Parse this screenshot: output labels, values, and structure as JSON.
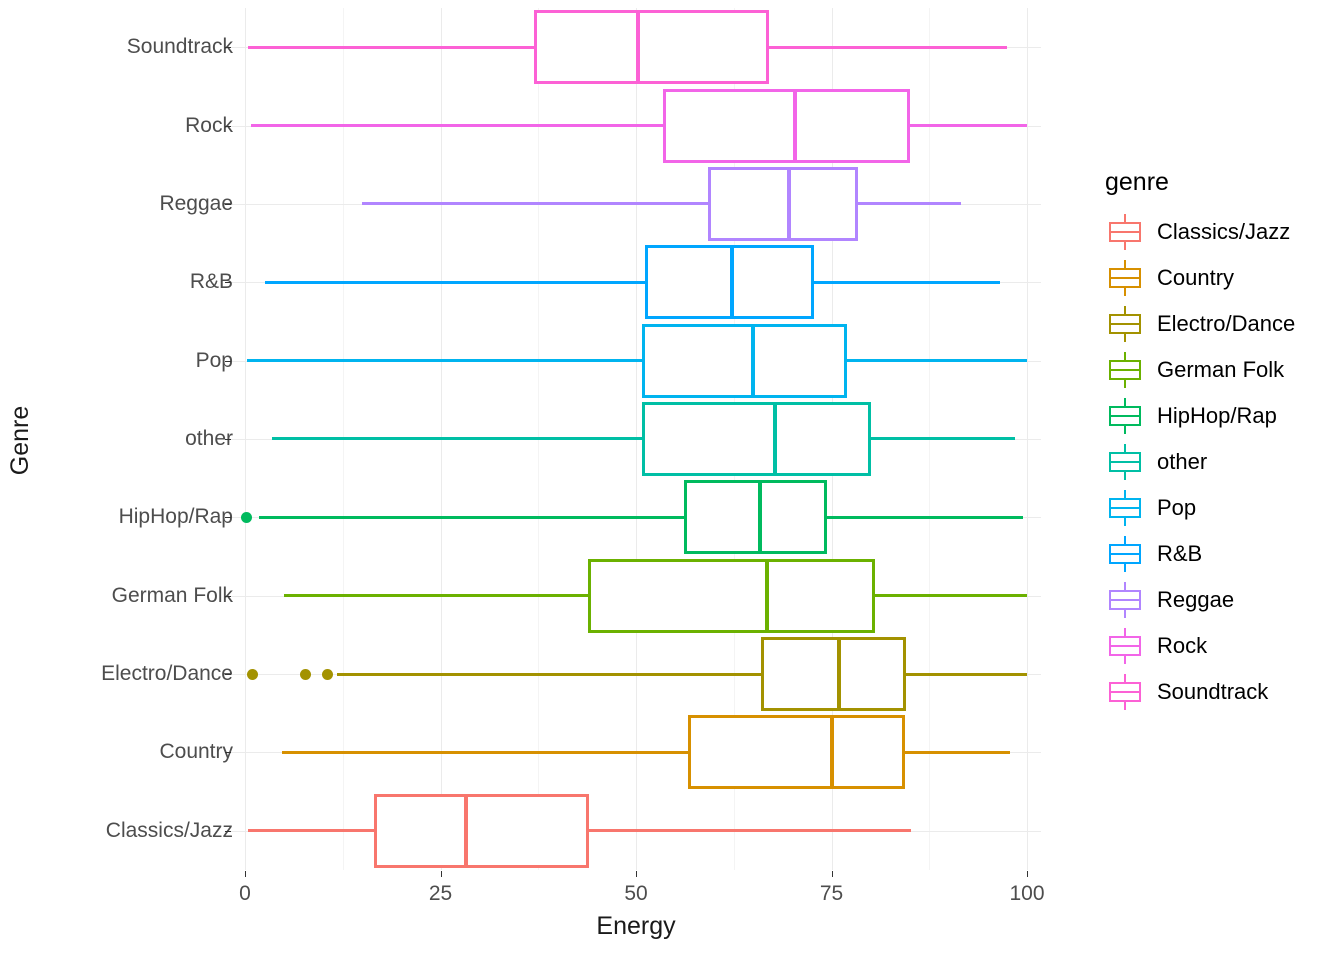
{
  "chart": {
    "type": "boxplot",
    "title": "",
    "xlabel": "Energy",
    "ylabel": "Genre",
    "legend_title": "genre",
    "legend_position": "right",
    "grid": true,
    "xlim": [
      -2,
      102
    ],
    "xticks": [
      "0",
      "25",
      "50",
      "75",
      "100"
    ],
    "xtick_values": [
      0,
      25,
      50,
      75,
      100
    ],
    "xminor_values": [
      12.5,
      37.5,
      62.5,
      87.5
    ]
  },
  "chart_data": {
    "type": "boxplot",
    "title": "",
    "xlabel": "Energy",
    "ylabel": "Genre",
    "legend_title": "genre",
    "legend_position": "right",
    "grid": true,
    "xlim": [
      -2,
      102
    ],
    "xticks": [
      0,
      25,
      50,
      75,
      100
    ],
    "orientation": "horizontal",
    "categories": [
      "Soundtrack",
      "Rock",
      "Reggae",
      "R&B",
      "Pop",
      "other",
      "HipHop/Rap",
      "German Folk",
      "Electro/Dance",
      "Country",
      "Classics/Jazz"
    ],
    "boxes": [
      {
        "category": "Soundtrack",
        "color": "#FC61D5",
        "whisker_low": 0.4,
        "q1": 37.0,
        "median": 50.2,
        "q3": 67.0,
        "whisker_high": 97.5,
        "outliers": []
      },
      {
        "category": "Rock",
        "color": "#F265E8",
        "whisker_low": 0.8,
        "q1": 53.5,
        "median": 70.3,
        "q3": 85.0,
        "whisker_high": 100.0,
        "outliers": []
      },
      {
        "category": "Reggae",
        "color": "#B185FF",
        "whisker_low": 15.0,
        "q1": 59.2,
        "median": 69.6,
        "q3": 78.4,
        "whisker_high": 91.5,
        "outliers": []
      },
      {
        "category": "R&B",
        "color": "#00A6FF",
        "whisker_low": 2.5,
        "q1": 51.2,
        "median": 62.3,
        "q3": 72.8,
        "whisker_high": 96.5,
        "outliers": []
      },
      {
        "category": "Pop",
        "color": "#00B4EF",
        "whisker_low": 0.2,
        "q1": 50.8,
        "median": 65.0,
        "q3": 77.0,
        "whisker_high": 100.0,
        "outliers": []
      },
      {
        "category": "other",
        "color": "#00BFA5",
        "whisker_low": 3.5,
        "q1": 50.8,
        "median": 67.8,
        "q3": 80.1,
        "whisker_high": 98.5,
        "outliers": []
      },
      {
        "category": "HipHop/Rap",
        "color": "#00BA5E",
        "whisker_low": 1.8,
        "q1": 56.2,
        "median": 65.9,
        "q3": 74.4,
        "whisker_high": 99.5,
        "outliers": [
          0.2
        ]
      },
      {
        "category": "German Folk",
        "color": "#6BB100",
        "whisker_low": 5.0,
        "q1": 43.9,
        "median": 66.8,
        "q3": 80.6,
        "whisker_high": 100.0,
        "outliers": []
      },
      {
        "category": "Electro/Dance",
        "color": "#A39200",
        "whisker_low": 11.8,
        "q1": 66.0,
        "median": 76.0,
        "q3": 84.5,
        "whisker_high": 100.0,
        "outliers": [
          1.0,
          7.8,
          10.5
        ]
      },
      {
        "category": "Country",
        "color": "#D79000",
        "whisker_low": 4.7,
        "q1": 56.6,
        "median": 75.1,
        "q3": 84.4,
        "whisker_high": 97.8,
        "outliers": []
      },
      {
        "category": "Classics/Jazz",
        "color": "#F8766D",
        "whisker_low": 0.4,
        "q1": 16.5,
        "median": 28.2,
        "q3": 44.0,
        "whisker_high": 85.2,
        "outliers": []
      }
    ]
  },
  "legend": {
    "title": "genre",
    "items": [
      {
        "label": "Classics/Jazz",
        "color": "#F8766D"
      },
      {
        "label": "Country",
        "color": "#D79000"
      },
      {
        "label": "Electro/Dance",
        "color": "#A39200"
      },
      {
        "label": "German Folk",
        "color": "#6BB100"
      },
      {
        "label": "HipHop/Rap",
        "color": "#00BA5E"
      },
      {
        "label": "other",
        "color": "#00BFA5"
      },
      {
        "label": "Pop",
        "color": "#00B4EF"
      },
      {
        "label": "R&B",
        "color": "#00A6FF"
      },
      {
        "label": "Reggae",
        "color": "#B185FF"
      },
      {
        "label": "Rock",
        "color": "#F265E8"
      },
      {
        "label": "Soundtrack",
        "color": "#FC61D5"
      }
    ]
  }
}
